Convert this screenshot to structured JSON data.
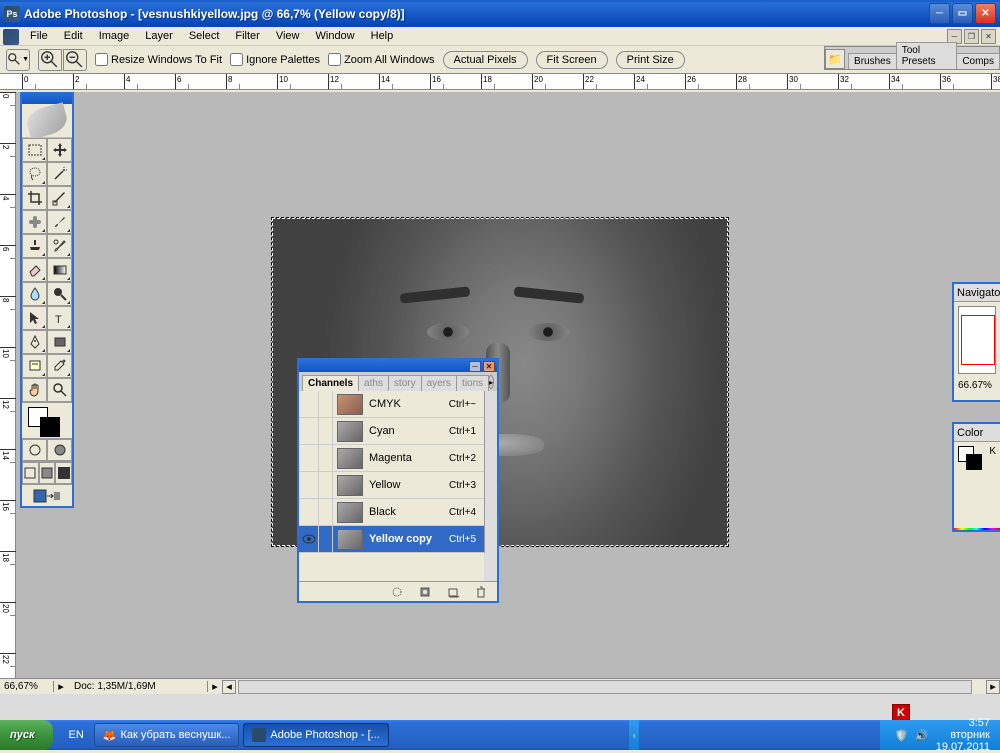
{
  "window": {
    "title": "Adobe Photoshop - [vesnushkiyellow.jpg @ 66,7% (Yellow copy/8)]"
  },
  "menu": {
    "file": "File",
    "edit": "Edit",
    "image": "Image",
    "layer": "Layer",
    "select": "Select",
    "filter": "Filter",
    "view": "View",
    "window": "Window",
    "help": "Help"
  },
  "options": {
    "resize_windows": "Resize Windows To Fit",
    "ignore_palettes": "Ignore Palettes",
    "zoom_all": "Zoom All Windows",
    "actual_pixels": "Actual Pixels",
    "fit_screen": "Fit Screen",
    "print_size": "Print Size"
  },
  "palettewell": {
    "brushes": "Brushes",
    "toolpresets": "Tool Presets",
    "comps": "Comps"
  },
  "channels": {
    "tab_channels": "Channels",
    "tab_paths": "aths",
    "tab_history": "story",
    "tab_layers": "ayers",
    "tab_actions": "tions",
    "rows": [
      {
        "name": "CMYK",
        "shortcut": "Ctrl+~",
        "thumb": "color"
      },
      {
        "name": "Cyan",
        "shortcut": "Ctrl+1",
        "thumb": "gray"
      },
      {
        "name": "Magenta",
        "shortcut": "Ctrl+2",
        "thumb": "gray"
      },
      {
        "name": "Yellow",
        "shortcut": "Ctrl+3",
        "thumb": "gray"
      },
      {
        "name": "Black",
        "shortcut": "Ctrl+4",
        "thumb": "gray"
      },
      {
        "name": "Yellow copy",
        "shortcut": "Ctrl+5",
        "thumb": "gray",
        "selected": true,
        "visible": true
      }
    ]
  },
  "navigator": {
    "tab": "Navigator",
    "zoom": "66.67%"
  },
  "color": {
    "tab": "Color",
    "model": "K"
  },
  "status": {
    "zoom": "66,67%",
    "doc": "Doc: 1,35M/1,69M"
  },
  "taskbar": {
    "start": "пуск",
    "lang": "EN",
    "task1": "Как убрать веснушк...",
    "task2": "Adobe Photoshop - [...",
    "time": "3:57",
    "day": "вторник",
    "date": "19.07.2011"
  }
}
